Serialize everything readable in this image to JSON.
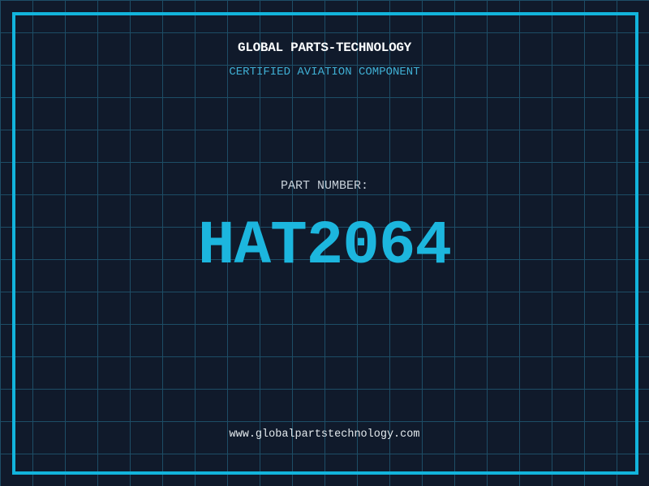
{
  "label": {
    "company_name": "GLOBAL PARTS-TECHNOLOGY",
    "certification_line": "CERTIFIED AVIATION COMPONENT",
    "part_number_label": "PART NUMBER:",
    "part_number": "HAT2064",
    "website_url": "www.globalpartstechnology.com"
  },
  "colors": {
    "background": "#101a2b",
    "grid_line": "#1d4d66",
    "frame_cyan": "#12b4dc",
    "part_number_cyan": "#1cb6de",
    "certification_cyan": "#3fafd4",
    "title_white": "#fafcfd",
    "label_gray": "#c6cfd8",
    "url_light": "#e4eaee"
  }
}
